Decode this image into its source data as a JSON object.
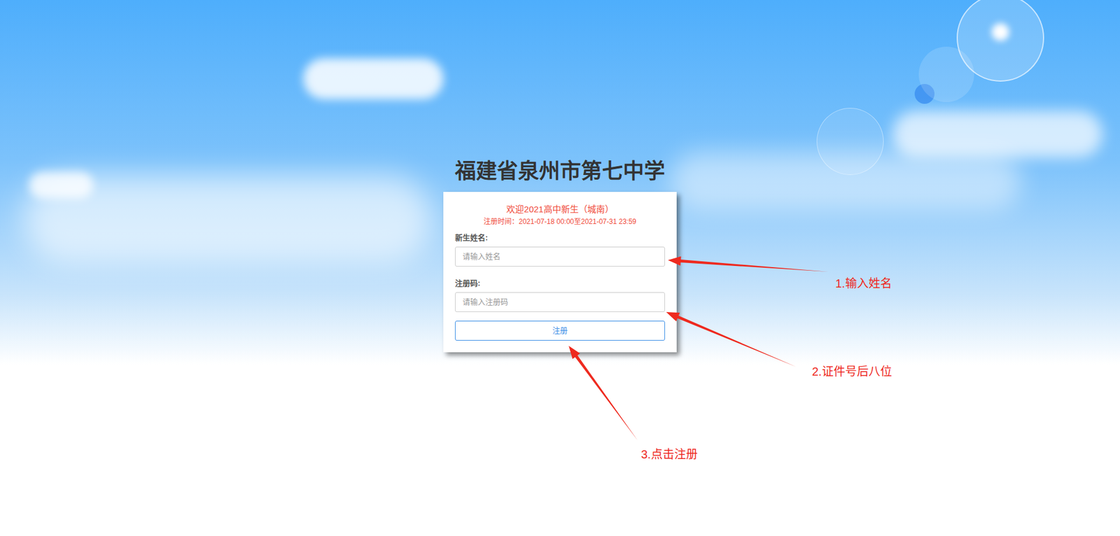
{
  "school": "福建省泉州市第七中学",
  "form": {
    "welcome": "欢迎2021高中新生（城南）",
    "period": "注册时间：2021-07-18 00:00至2021-07-31 23:59",
    "fields": [
      {
        "label": "新生姓名:",
        "placeholder": "请输入姓名"
      },
      {
        "label": "注册码:",
        "placeholder": "请输入注册码"
      }
    ],
    "submit": "注册"
  },
  "annotations": [
    {
      "text": "1.输入姓名"
    },
    {
      "text": "2.证件号后八位"
    },
    {
      "text": "3.点击注册"
    }
  ]
}
